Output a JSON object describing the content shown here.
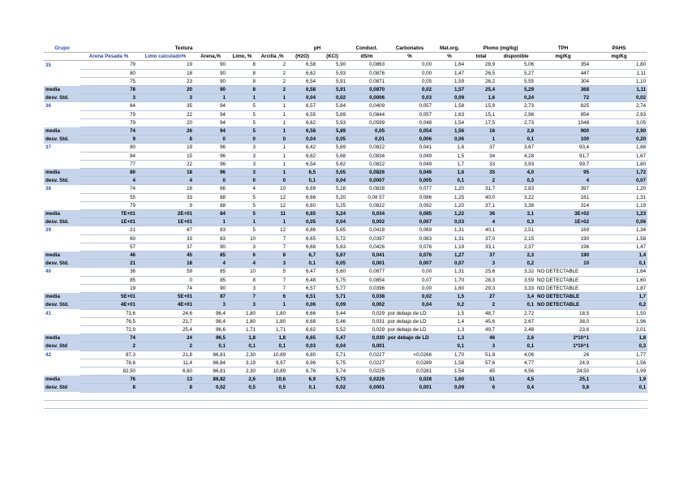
{
  "columns": 17,
  "header1": {
    "grupo": "Grupo",
    "textura": "Textura",
    "ph": "pH",
    "conduct": "Conduct.",
    "carbonatos": "Carbonatos",
    "matorg": "Mat.org.",
    "plomo": "Plomo (mg/kg)",
    "tph": "TPH",
    "pahs": "PAHS"
  },
  "header2": [
    "",
    "Arena Pesada %",
    "Limo calculado%",
    "Arena,%",
    "Limo, %",
    "Arcilla ,%",
    "(H2O)",
    "(KCl)",
    "dS/m",
    "%",
    "%",
    "total",
    "disponible",
    "mg/Kg",
    "mg/Kg"
  ],
  "rows": [
    {
      "t": "d",
      "c": [
        "35",
        "79",
        "19",
        "90",
        "8",
        "2",
        "6,58",
        "5,90",
        "0,0863",
        "0,00",
        "1,64",
        "28,9",
        "5,06",
        "354",
        "1,80"
      ]
    },
    {
      "t": "d",
      "c": [
        "",
        "80",
        "18",
        "90",
        "8",
        "2",
        "6,62",
        "5,93",
        "0,0876",
        "0,00",
        "1,47",
        "26,5",
        "5,27",
        "447",
        "1,11"
      ]
    },
    {
      "t": "d",
      "c": [
        "",
        "75",
        "23",
        "90",
        "8",
        "2",
        "6,54",
        "5,91",
        "0,0871",
        "0,05",
        "1,59",
        "26,2",
        "5,55",
        "304",
        "1,10"
      ]
    },
    {
      "t": "s",
      "c": [
        "media",
        "78",
        "20",
        "90",
        "8",
        "2",
        "6,58",
        "5,91",
        "0,0870",
        "0,02",
        "1,57",
        "25,4",
        "5,29",
        "368",
        "1,11"
      ]
    },
    {
      "t": "s",
      "c": [
        "desv. Std.",
        "3",
        "3",
        "1",
        "1",
        "1",
        "0,04",
        "0,02",
        "0,0006",
        "0,03",
        "0,09",
        "1,6",
        "0,24",
        "72",
        "0,02"
      ]
    },
    {
      "t": "d",
      "c": [
        "36",
        "64",
        "35",
        "94",
        "5",
        "1",
        "6,57",
        "5,84",
        "0,0409",
        "0,057",
        "1,58",
        "15,9",
        "2,73",
        "825",
        "2,74"
      ]
    },
    {
      "t": "d",
      "c": [
        "",
        "79",
        "22",
        "94",
        "5",
        "1",
        "6,55",
        "5,89",
        "0,0844",
        "0,057",
        "1,63",
        "15,1",
        "2,98",
        "854",
        "2,93"
      ]
    },
    {
      "t": "d",
      "c": [
        "",
        "79",
        "20",
        "94",
        "5",
        "1",
        "6,62",
        "5,93",
        "0,0599",
        "0,048",
        "1,54",
        "17,5",
        "2,73",
        "1048",
        "3,05"
      ]
    },
    {
      "t": "s",
      "c": [
        "media",
        "74",
        "26",
        "94",
        "5",
        "1",
        "6,58",
        "5,89",
        "0,05",
        "0,054",
        "1,56",
        "16",
        "2,8",
        "900",
        "2,90"
      ]
    },
    {
      "t": "s",
      "c": [
        "desv. Std.",
        "9",
        "8",
        "0",
        "0",
        "0",
        "0,04",
        "0,05",
        "0,01",
        "0,006",
        "0,06",
        "1",
        "0,1",
        "100",
        "0,20"
      ]
    },
    {
      "t": "d",
      "c": [
        "37",
        "80",
        "19",
        "96",
        "3",
        "1",
        "6,42",
        "5,69",
        "0,0822",
        "0,041",
        "1,6",
        "37",
        "3,67",
        "93,4",
        "1,68"
      ]
    },
    {
      "t": "d",
      "c": [
        "",
        "84",
        "15",
        "96",
        "3",
        "1",
        "6,62",
        "5,68",
        "0,0834",
        "0,049",
        "1,5",
        "34",
        "4,28",
        "91,7",
        "1,67"
      ]
    },
    {
      "t": "d",
      "c": [
        "",
        "77",
        "22",
        "96",
        "3",
        "1",
        "6,54",
        "5,62",
        "0,0822",
        "0,049",
        "1,7",
        "33",
        "3,93",
        "99,7",
        "1,80"
      ]
    },
    {
      "t": "s",
      "c": [
        "media",
        "80",
        "18",
        "96",
        "3",
        "1",
        "6,5",
        "5,65",
        "0,0826",
        "0,046",
        "1,6",
        "35",
        "4,0",
        "95",
        "1,72"
      ]
    },
    {
      "t": "s",
      "c": [
        "desv. Std.",
        "4",
        "4",
        "0",
        "0",
        "0",
        "0,1",
        "0,04",
        "0,0007",
        "0,005",
        "0,1",
        "2",
        "0,3",
        "4",
        "0,07"
      ]
    },
    {
      "t": "d",
      "c": [
        "38",
        "74",
        "16",
        "86",
        "4",
        "10",
        "6,69",
        "5,28",
        "0,0828",
        "0,077",
        "1,20",
        "31,7",
        "2,83",
        "397",
        "1,20"
      ]
    },
    {
      "t": "d",
      "c": [
        "",
        "55",
        "33",
        "88",
        "5",
        "12",
        "6,66",
        "5,20",
        "0,08 57",
        "0,086",
        "1,25",
        "40,0",
        "3,22",
        "161",
        "1,31"
      ]
    },
    {
      "t": "d",
      "c": [
        "",
        "79",
        "9",
        "88",
        "5",
        "12",
        "6,60",
        "5,25",
        "0,0822",
        "0,092",
        "1,20",
        "37,1",
        "3,38",
        "314",
        "1,19"
      ]
    },
    {
      "t": "s",
      "c": [
        "media",
        "7E+01",
        "2E+01",
        "84",
        "5",
        "11",
        "6,65",
        "5,24",
        "0,034",
        "0,085",
        "1,22",
        "36",
        "3,1",
        "3E+02",
        "1,23"
      ]
    },
    {
      "t": "s",
      "c": [
        "desv. Std.",
        "1E+01",
        "1E+01",
        "1",
        "1",
        "1",
        "0,05",
        "0,04",
        "0,002",
        "0,007",
        "0,03",
        "4",
        "0,3",
        "1E+02",
        "0,06"
      ]
    },
    {
      "t": "d",
      "c": [
        "39",
        "21",
        "67",
        "83",
        "5",
        "12",
        "6,86",
        "5,65",
        "0,0418",
        "0,069",
        "1,31",
        "40,1",
        "2,51",
        "169",
        "1,34"
      ]
    },
    {
      "t": "d",
      "c": [
        "",
        "60",
        "33",
        "83",
        "10",
        "7",
        "6,65",
        "5,72",
        "0,0397",
        "0,083",
        "1,31",
        "37,0",
        "2,15",
        "190",
        "1,58"
      ]
    },
    {
      "t": "d",
      "c": [
        "",
        "57",
        "37",
        "90",
        "3",
        "7",
        "6,68",
        "5,63",
        "0,0426",
        "0,076",
        "1,19",
        "33,1",
        "2,37",
        "196",
        "1,47"
      ]
    },
    {
      "t": "s",
      "c": [
        "media",
        "46",
        "45",
        "85",
        "6",
        "8",
        "6,7",
        "5,67",
        "0,041",
        "0,076",
        "1,27",
        "37",
        "2,3",
        "190",
        "1,4"
      ]
    },
    {
      "t": "s",
      "c": [
        "desv. Std.",
        "21",
        "18",
        "4",
        "4",
        "3",
        "0,1",
        "0,05",
        "0,001",
        "0,007",
        "0,07",
        "3",
        "0,2",
        "10",
        "0,1"
      ]
    },
    {
      "t": "d",
      "c": [
        "40",
        "36",
        "59",
        "85",
        "10",
        "5",
        "6,47",
        "5,60",
        "0,0877",
        "0,00",
        "1,31",
        "25,6",
        "3,32",
        "NO DETECTABLE",
        "1,64"
      ]
    },
    {
      "t": "d",
      "c": [
        "",
        "85",
        "0",
        "85",
        "8",
        "7",
        "6,48",
        "5,75",
        "0,0854",
        "0,07",
        "1,70",
        "28,3",
        "3,59",
        "NO DETECTABLE",
        "1,60"
      ]
    },
    {
      "t": "d",
      "c": [
        "",
        "19",
        "74",
        "90",
        "3",
        "7",
        "6,57",
        "5,77",
        "0,0396",
        "0,00",
        "1,60",
        "29,3",
        "3,33",
        "NO DETECTABLE",
        "1,87"
      ]
    },
    {
      "t": "s",
      "c": [
        "media",
        "5E+01",
        "5E+01",
        "87",
        "7",
        "6",
        "6,51",
        "5,71",
        "0,038",
        "0,02",
        "1,5",
        "27",
        "3,4",
        "NO DETECTABLE",
        "1,7"
      ]
    },
    {
      "t": "s",
      "c": [
        "desv. Std.",
        "4E+01",
        "4E+01",
        "3",
        "3",
        "1",
        "0,06",
        "0,09",
        "0,002",
        "0,04",
        "0,2",
        "2",
        "0,1",
        "NO DETECTABLE",
        "0,2"
      ]
    },
    {
      "t": "d",
      "c": [
        "41",
        "73,6",
        "24,6",
        "96,4",
        "1,80",
        "1,80",
        "6,66",
        "5,44",
        "0,029",
        "por debajo de LD",
        "1,5",
        "48,7",
        "2,72",
        "18,5",
        "1,50"
      ]
    },
    {
      "t": "d",
      "c": [
        "",
        "76,5",
        "21,7",
        "96,4",
        "1,80",
        "1,80",
        "6,68",
        "5,46",
        "0,031",
        "por debajo de LD",
        "1,4",
        "45,6",
        "2,67",
        "38,0",
        "1,96"
      ]
    },
    {
      "t": "d",
      "c": [
        "",
        "72,9",
        "25,4",
        "96,6",
        "1,71",
        "1,71",
        "6,62",
        "5,52",
        "0,029",
        "por debajo de LD",
        "1,3",
        "49,7",
        "2,48",
        "23,6",
        "2,01"
      ]
    },
    {
      "t": "s",
      "c": [
        "media",
        "74",
        "24",
        "96,5",
        "1,8",
        "1,8",
        "6,65",
        "5,47",
        "0,030",
        "por debajo de LD",
        "1,3",
        "46",
        "2,6",
        "3*10^1",
        "1,8"
      ]
    },
    {
      "t": "s",
      "c": [
        "desv. Std",
        "2",
        "2",
        "0,1",
        "0,1",
        "0,1",
        "0,03",
        "0,04",
        "0,001",
        "",
        "0,1",
        "3",
        "0,1",
        "1*10^1",
        "0,3"
      ]
    },
    {
      "t": "d",
      "c": [
        "42",
        "87,3",
        "21,8",
        "86,81",
        "2,30",
        "10,89",
        "6,80",
        "5,71",
        "0,0227",
        "<0,0266",
        "1,70",
        "51,8",
        "4,06",
        "26",
        "1,77"
      ]
    },
    {
      "t": "d",
      "c": [
        "",
        "78,6",
        "11,4",
        "86,84",
        "3,19",
        "9,97",
        "6,96",
        "5,75",
        "0,0227",
        "0,0289",
        "1,58",
        "57,6",
        "4,77",
        "24,9",
        "1,56"
      ]
    },
    {
      "t": "d",
      "c": [
        "",
        "82,50",
        "6,60",
        "86,81",
        "2,30",
        "10,89",
        "6,76",
        "5,74",
        "0,0225",
        "0,0281",
        "1,54",
        "45",
        "4,56",
        "24,50",
        "1,99"
      ]
    },
    {
      "t": "s",
      "c": [
        "media",
        "76",
        "13",
        "86,82",
        "2,6",
        "10,6",
        "6,9",
        "5,73",
        "0,0226",
        "0,028",
        "1,60",
        "51",
        "4,5",
        "25,1",
        "1,9"
      ]
    },
    {
      "t": "s",
      "c": [
        "desv. Std",
        "8",
        "8",
        "0,02",
        "0,5",
        "0,5",
        "0,1",
        "0,02",
        "0,0001",
        "0,001",
        "0,09",
        "6",
        "0,4",
        "0,8",
        "0,1"
      ]
    },
    {
      "t": "e",
      "c": [
        "",
        "",
        "",
        "",
        "",
        "",
        "",
        "",
        "",
        "",
        "",
        "",
        "",
        "",
        ""
      ]
    },
    {
      "t": "e",
      "c": [
        "",
        "",
        "",
        "",
        "",
        "",
        "",
        "",
        "",
        "",
        "",
        "",
        "",
        "",
        ""
      ]
    }
  ]
}
